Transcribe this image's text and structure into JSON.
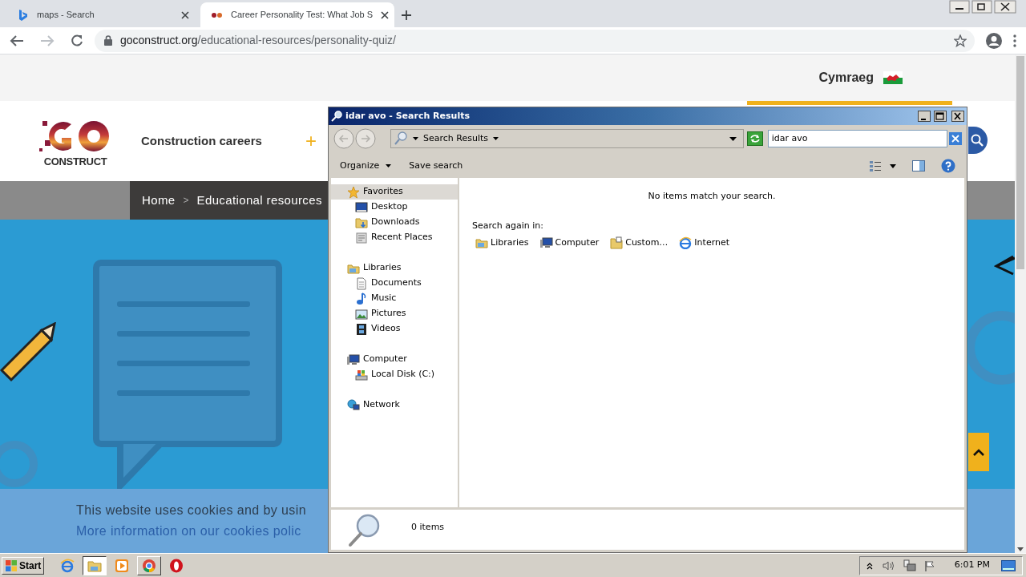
{
  "browser": {
    "tabs": [
      {
        "title": "maps - Search",
        "selected": false
      },
      {
        "title": "Career Personality Test: What Job S",
        "selected": true
      }
    ],
    "url_host": "goconstruct.org",
    "url_path": "/educational-resources/personality-quiz/"
  },
  "website": {
    "language": "Cymraeg",
    "logo_text": "CONSTRUCT",
    "nav_label": "Construction careers",
    "nav_plus": "+",
    "breadcrumb": [
      "Home",
      "Educational resources"
    ],
    "breadcrumb_separator": ">",
    "cookie_lines": [
      {
        "text": "This website uses cookies and by usin",
        "kind": "plain"
      },
      {
        "text": "More information on our cookies polic",
        "kind": "link"
      }
    ]
  },
  "explorer": {
    "title": "idar avo - Search Results",
    "address": "Search Results",
    "search_value": "idar avo",
    "toolbar": [
      "Organize",
      "Save search"
    ],
    "nav_tree": [
      {
        "label": "Favorites",
        "selected": true,
        "children": [
          {
            "label": "Desktop",
            "selected": false
          },
          {
            "label": "Downloads",
            "selected": false
          },
          {
            "label": "Recent Places",
            "selected": false
          }
        ]
      },
      {
        "label": "Libraries",
        "selected": false,
        "children": [
          {
            "label": "Documents",
            "selected": false
          },
          {
            "label": "Music",
            "selected": false
          },
          {
            "label": "Pictures",
            "selected": false
          },
          {
            "label": "Videos",
            "selected": false
          }
        ]
      },
      {
        "label": "Computer",
        "selected": false,
        "children": [
          {
            "label": "Local Disk (C:)",
            "selected": false
          }
        ]
      },
      {
        "label": "Network",
        "selected": false
      }
    ],
    "message": "No items match your search.",
    "search_again_label": "Search again in:",
    "search_again_items": [
      "Libraries",
      "Computer",
      "Custom…",
      "Internet"
    ],
    "status": "0 items"
  },
  "taskbar": {
    "start": "Start",
    "apps": [
      {
        "kind": "ie",
        "open": false,
        "selected": false
      },
      {
        "kind": "explorer",
        "open": true,
        "selected": true
      },
      {
        "kind": "media",
        "open": false,
        "selected": false
      },
      {
        "kind": "chrome",
        "open": true,
        "selected": false
      },
      {
        "kind": "opera",
        "open": false,
        "selected": false
      }
    ],
    "time": "6:01 PM"
  }
}
